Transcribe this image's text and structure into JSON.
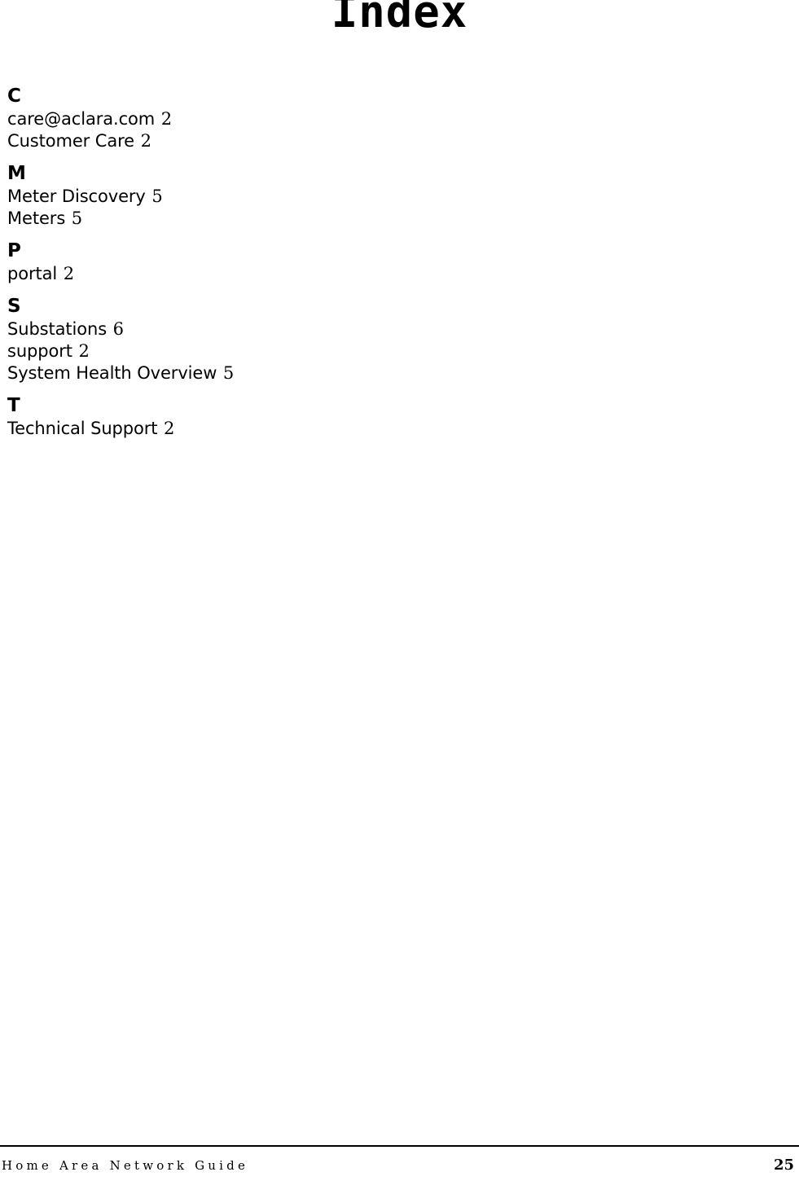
{
  "document": {
    "title": "Index"
  },
  "index": {
    "sections": [
      {
        "letter": "C",
        "entries": [
          {
            "term": "care@aclara.com",
            "page": "2"
          },
          {
            "term": "Customer Care",
            "page": "2"
          }
        ]
      },
      {
        "letter": "M",
        "entries": [
          {
            "term": "Meter Discovery",
            "page": "5"
          },
          {
            "term": "Meters",
            "page": "5"
          }
        ]
      },
      {
        "letter": "P",
        "entries": [
          {
            "term": "portal",
            "page": "2"
          }
        ]
      },
      {
        "letter": "S",
        "entries": [
          {
            "term": "Substations",
            "page": "6"
          },
          {
            "term": "support",
            "page": "2"
          },
          {
            "term": "System Health Overview",
            "page": "5"
          }
        ]
      },
      {
        "letter": "T",
        "entries": [
          {
            "term": "Technical Support",
            "page": "2"
          }
        ]
      }
    ]
  },
  "footer": {
    "guide_name": "Home Area Network Guide",
    "page_number": "25"
  }
}
